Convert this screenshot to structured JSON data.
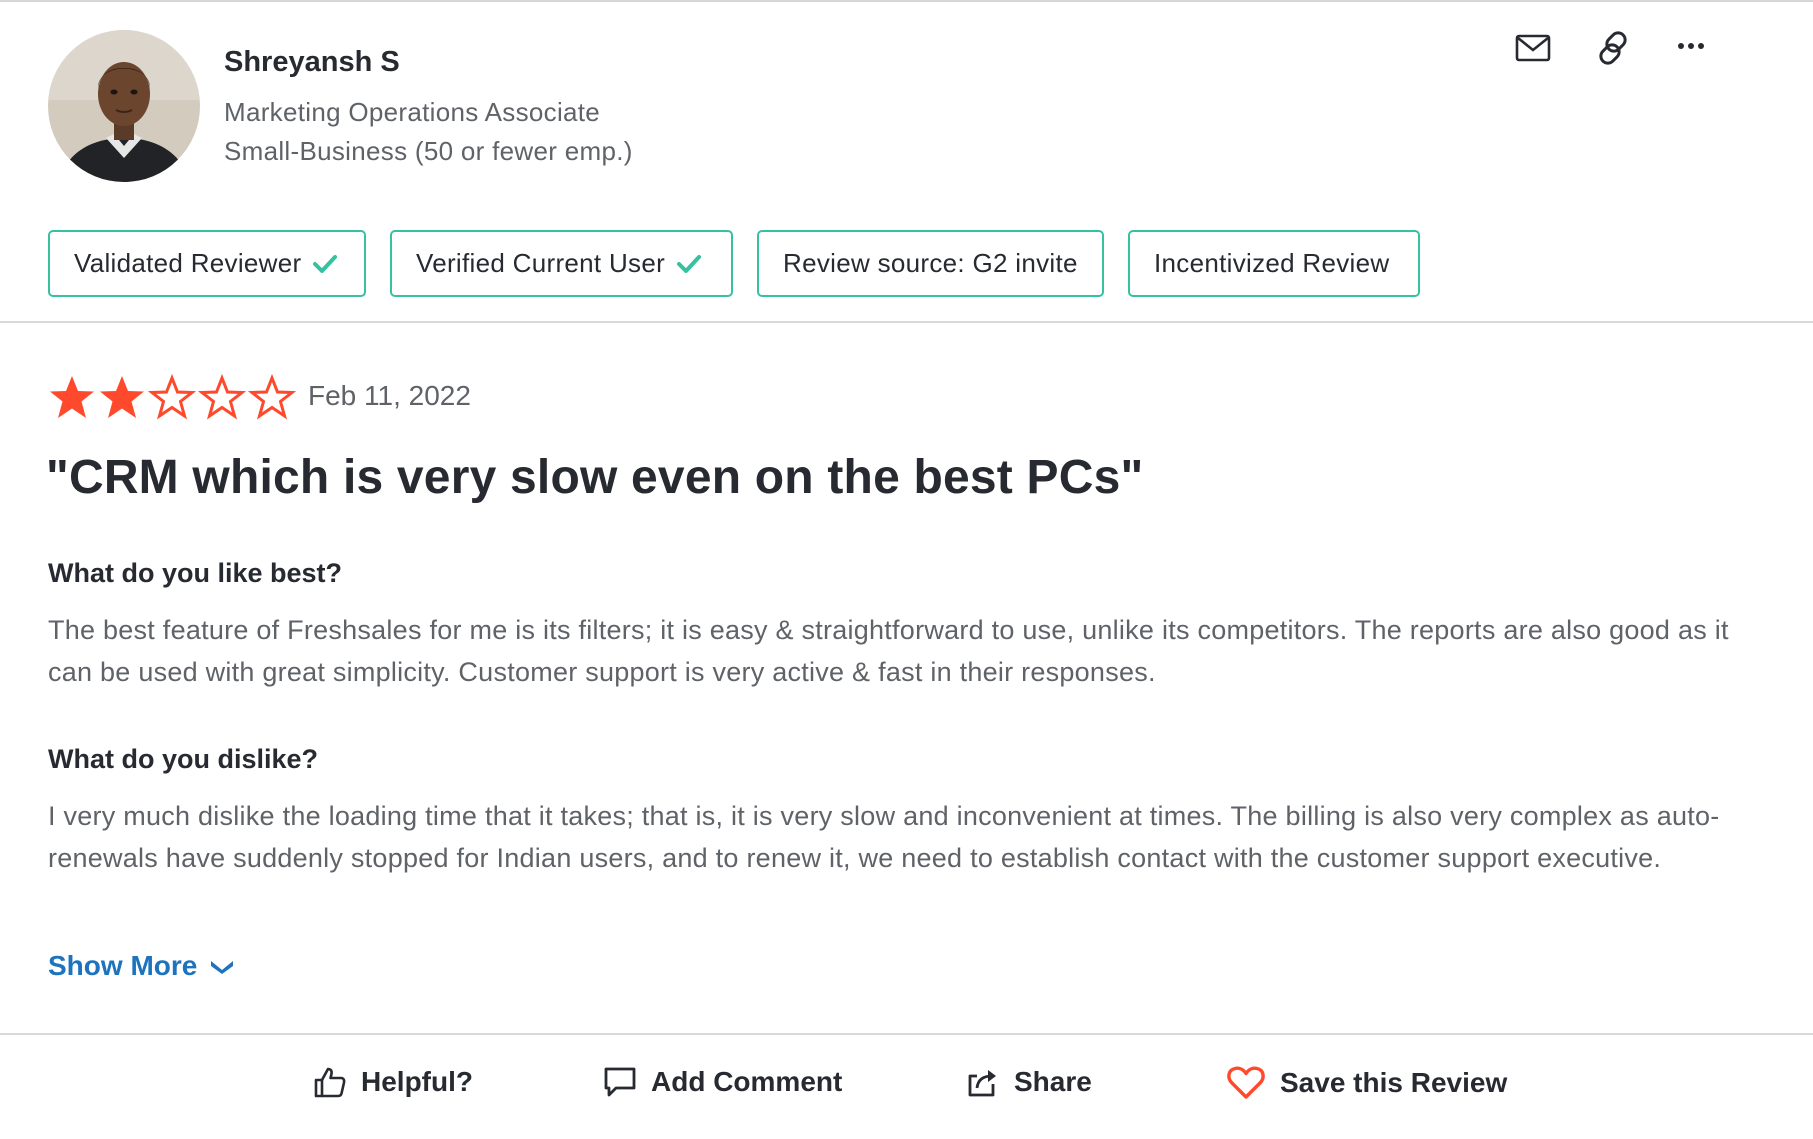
{
  "reviewer": {
    "name": "Shreyansh S",
    "title": "Marketing Operations Associate",
    "company": "Small-Business (50 or fewer emp.)"
  },
  "top_actions": [
    {
      "icon": "mail-icon"
    },
    {
      "icon": "link-icon"
    },
    {
      "icon": "more-options-icon"
    }
  ],
  "badges": [
    {
      "label": "Validated Reviewer",
      "checked": true
    },
    {
      "label": "Verified Current User",
      "checked": true
    },
    {
      "label": "Review source: G2 invite",
      "checked": false
    },
    {
      "label": "Incentivized Review",
      "checked": false
    }
  ],
  "review": {
    "rating": 2,
    "max_rating": 5,
    "date": "Feb 11, 2022",
    "title": "\"CRM which is very slow even on the best PCs\"",
    "questions": [
      {
        "question": "What do you like best?",
        "answer": "The best feature of Freshsales for me is its filters; it is easy & straightforward to use, unlike its competitors. The reports are also good as it can be used with great simplicity. Customer support is very active & fast in their responses."
      },
      {
        "question": "What do you dislike?",
        "answer": "I very much dislike the loading time that it takes; that is, it is very slow and inconvenient at times. The billing is also very complex as auto-renewals have suddenly stopped for Indian users, and to renew it, we need to establish contact with the customer support executive."
      }
    ],
    "show_more": "Show More"
  },
  "footer_actions": {
    "helpful": "Helpful?",
    "add_comment": "Add Comment",
    "share": "Share",
    "save": "Save this Review"
  },
  "colors": {
    "star_filled": "#ff492c",
    "badge_border": "#36c1a0",
    "link": "#1e73be",
    "heart": "#ff492c"
  }
}
